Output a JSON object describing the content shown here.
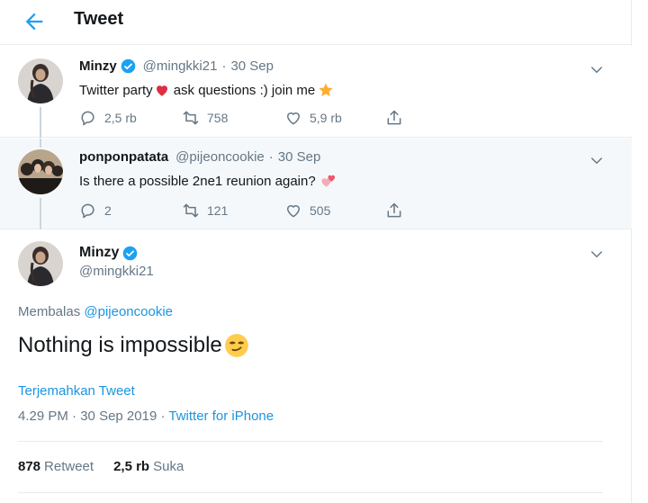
{
  "header": {
    "title": "Tweet",
    "back_icon": "arrow-left-icon"
  },
  "colors": {
    "accent": "#1da1f2",
    "link": "#1b95e0",
    "muted": "#657786",
    "like_heart": "#e0245e",
    "verified": "#1da1f2"
  },
  "tweets": [
    {
      "name": "Minzy",
      "verified": true,
      "handle": "@mingkki21",
      "date": "30 Sep",
      "text_a": "Twitter party",
      "text_b": "ask questions :) join me",
      "emoji_1": "red-heart-icon",
      "emoji_2": "star-icon",
      "replies": "2,5 rb",
      "retweets": "758",
      "likes": "5,9 rb"
    },
    {
      "name": "ponponpatata",
      "verified": false,
      "handle": "@pijeoncookie",
      "date": "30 Sep",
      "text": "Is there a possible 2ne1 reunion again?",
      "emoji_1": "two-hearts-icon",
      "replies": "2",
      "retweets": "121",
      "likes": "505"
    }
  ],
  "main_tweet": {
    "name": "Minzy",
    "verified": true,
    "handle": "@mingkki21",
    "reply_prefix": "Membalas",
    "reply_to": "@pijeoncookie",
    "text": "Nothing is impossible",
    "emoji": "smirking-face-icon",
    "translate": "Terjemahkan Tweet",
    "time": "4.29 PM",
    "date": "30 Sep 2019",
    "source": "Twitter for iPhone",
    "retweets_count": "878",
    "retweets_label": "Retweet",
    "likes_count": "2,5 rb",
    "likes_label": "Suka"
  }
}
